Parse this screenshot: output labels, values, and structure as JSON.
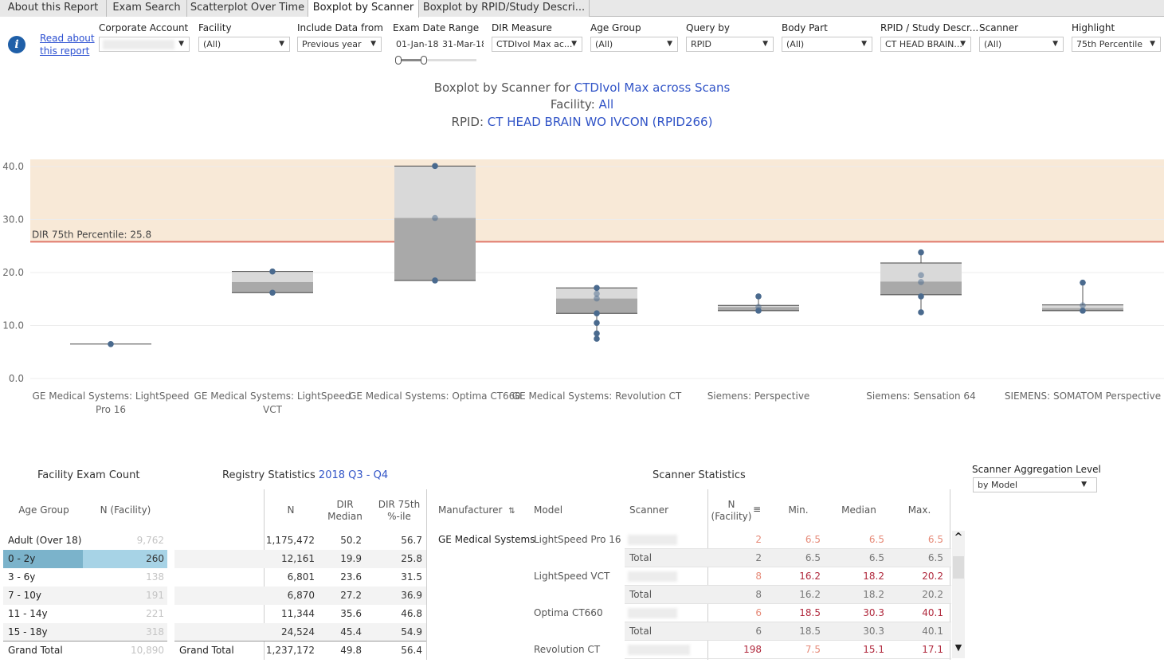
{
  "tabs": [
    {
      "label": "About this Report"
    },
    {
      "label": "Exam Search"
    },
    {
      "label": "Scatterplot Over Time"
    },
    {
      "label": "Boxplot by Scanner"
    },
    {
      "label": "Boxplot by RPID/Study Descri..."
    }
  ],
  "read_about": {
    "line1": "Read about",
    "line2": "this report"
  },
  "filters": {
    "corporate_account": {
      "label": "Corporate Account",
      "value": ""
    },
    "facility": {
      "label": "Facility",
      "value": "(All)"
    },
    "include_data_from": {
      "label": "Include Data from",
      "value": "Previous year"
    },
    "exam_date_range": {
      "label": "Exam Date Range",
      "start": "01-Jan-18",
      "end": "31-Mar-18"
    },
    "dir_measure": {
      "label": "DIR Measure",
      "value": "CTDIvol Max ac..."
    },
    "age_group": {
      "label": "Age Group",
      "value": "(All)"
    },
    "query_by": {
      "label": "Query by",
      "value": "RPID"
    },
    "body_part": {
      "label": "Body Part",
      "value": "(All)"
    },
    "rpid_study": {
      "label": "RPID / Study Descr...",
      "value": "CT HEAD BRAIN..."
    },
    "scanner": {
      "label": "Scanner",
      "value": "(All)"
    },
    "highlight": {
      "label": "Highlight",
      "value": "75th Percentile"
    }
  },
  "title": {
    "line1_prefix": "Boxplot by Scanner for ",
    "line1_measure": "CTDIvol Max across Scans",
    "line2_prefix": "Facility: ",
    "line2_value": "All",
    "line3_prefix": "RPID: ",
    "line3_value": "CT HEAD BRAIN WO IVCON (RPID266)"
  },
  "chart_data": {
    "type": "boxplot",
    "ylim": [
      0,
      42.5
    ],
    "yticks": [
      0,
      10,
      20,
      30,
      40
    ],
    "ytick_labels": [
      "0.0",
      "10.0",
      "20.0",
      "30.0",
      "40.0"
    ],
    "reference_line": {
      "label": "DIR 75th Percentile: 25.8",
      "value": 25.8
    },
    "categories": [
      "GE Medical Systems: LightSpeed Pro 16",
      "GE Medical Systems: LightSpeed VCT",
      "GE Medical Systems: Optima CT660",
      "GE Medical Systems: Revolution CT",
      "Siemens: Perspective",
      "Siemens: Sensation 64",
      "SIEMENS: SOMATOM Perspective"
    ],
    "category_lines": [
      [
        "GE Medical Systems: LightSpeed",
        "Pro 16"
      ],
      [
        "GE Medical Systems: LightSpeed",
        "VCT"
      ],
      [
        "GE Medical Systems: Optima CT660"
      ],
      [
        "GE Medical Systems: Revolution CT"
      ],
      [
        "Siemens: Perspective"
      ],
      [
        "Siemens: Sensation 64"
      ],
      [
        "SIEMENS: SOMATOM Perspective"
      ]
    ],
    "boxes": [
      {
        "min": 6.5,
        "q1": 6.5,
        "median": 6.5,
        "q3": 6.5,
        "max": 6.5,
        "points": [
          6.5
        ]
      },
      {
        "min": 16.2,
        "q1": 16.2,
        "median": 18.2,
        "q3": 20.2,
        "max": 20.2,
        "points": [
          16.2,
          20.2
        ]
      },
      {
        "min": 18.5,
        "q1": 18.5,
        "median": 30.3,
        "q3": 40.1,
        "max": 40.1,
        "points": [
          18.5,
          30.3,
          40.1
        ]
      },
      {
        "min": 7.5,
        "q1": 12.3,
        "median": 15.1,
        "q3": 17.1,
        "max": 17.1,
        "points": [
          7.5,
          8.5,
          10.5,
          12.3,
          15.1,
          16.0,
          17.1
        ]
      },
      {
        "min": 12.8,
        "q1": 12.8,
        "median": 13.5,
        "q3": 13.8,
        "max": 15.5,
        "points": [
          12.8,
          13.5,
          15.5
        ]
      },
      {
        "min": 12.5,
        "q1": 15.8,
        "median": 18.3,
        "q3": 21.8,
        "max": 23.8,
        "points": [
          12.5,
          15.5,
          18.2,
          19.5,
          23.8
        ]
      },
      {
        "min": 12.8,
        "q1": 12.8,
        "median": 13.3,
        "q3": 13.9,
        "max": 18.1,
        "points": [
          12.8,
          13.8,
          18.1
        ]
      }
    ]
  },
  "facility_exam_count": {
    "title": "Facility Exam Count",
    "col_age_group": "Age Group",
    "col_n": "N (Facility)",
    "rows": [
      {
        "age": "Adult (Over 18)",
        "n": "9,762"
      },
      {
        "age": "0 - 2y",
        "n": "260"
      },
      {
        "age": "3 - 6y",
        "n": "138"
      },
      {
        "age": "7 - 10y",
        "n": "191"
      },
      {
        "age": "11 - 14y",
        "n": "221"
      },
      {
        "age": "15 - 18y",
        "n": "318"
      }
    ],
    "grand_total": {
      "label": "Grand Total",
      "n": "10,890"
    }
  },
  "registry_statistics": {
    "title_prefix": "Registry Statistics ",
    "title_period": "2018 Q3 - Q4",
    "col_n": "N",
    "col_median_1": "DIR",
    "col_median_2": "Median",
    "col_p75_1": "DIR 75th",
    "col_p75_2": "%-ile",
    "rows": [
      {
        "n": "1,175,472",
        "median": "50.2",
        "p75": "56.7"
      },
      {
        "n": "12,161",
        "median": "19.9",
        "p75": "25.8"
      },
      {
        "n": "6,801",
        "median": "23.6",
        "p75": "31.5"
      },
      {
        "n": "6,870",
        "median": "27.2",
        "p75": "36.9"
      },
      {
        "n": "11,344",
        "median": "35.6",
        "p75": "46.8"
      },
      {
        "n": "24,524",
        "median": "45.4",
        "p75": "54.9"
      }
    ],
    "grand_total": {
      "label": "Grand Total",
      "n": "1,237,172",
      "median": "49.8",
      "p75": "56.4"
    }
  },
  "scanner_statistics": {
    "title": "Scanner Statistics",
    "col_manufacturer": "Manufacturer",
    "col_model": "Model",
    "col_scanner": "Scanner",
    "col_n_1": "N",
    "col_n_2": "(Facility)",
    "col_min": "Min.",
    "col_median": "Median",
    "col_max": "Max.",
    "rows": [
      {
        "manufacturer": "GE Medical Systems",
        "model": "LightSpeed Pro 16",
        "scanner": "",
        "n": "2",
        "min": "6.5",
        "median": "6.5",
        "max": "6.5",
        "style": "pink"
      },
      {
        "manufacturer": "",
        "model": "",
        "scanner": "Total",
        "n": "2",
        "min": "6.5",
        "median": "6.5",
        "max": "6.5",
        "style": "total"
      },
      {
        "manufacturer": "",
        "model": "LightSpeed VCT",
        "scanner": "",
        "n": "8",
        "min": "16.2",
        "median": "18.2",
        "max": "20.2",
        "style": "red"
      },
      {
        "manufacturer": "",
        "model": "",
        "scanner": "Total",
        "n": "8",
        "min": "16.2",
        "median": "18.2",
        "max": "20.2",
        "style": "total"
      },
      {
        "manufacturer": "",
        "model": "Optima CT660",
        "scanner": "",
        "n": "6",
        "min": "18.5",
        "median": "30.3",
        "max": "40.1",
        "style": "red"
      },
      {
        "manufacturer": "",
        "model": "",
        "scanner": "Total",
        "n": "6",
        "min": "18.5",
        "median": "30.3",
        "max": "40.1",
        "style": "total"
      },
      {
        "manufacturer": "",
        "model": "Revolution CT",
        "scanner": "",
        "n": "198",
        "min": "7.5",
        "median": "15.1",
        "max": "17.1",
        "style": "mixed"
      }
    ]
  },
  "scanner_aggregation": {
    "label": "Scanner Aggregation Level",
    "value": "by Model"
  },
  "colors": {
    "highlight_band": "#f8e9d7",
    "reference_line": "#e0786b",
    "box_dark": "#a9a9a9",
    "box_light": "#d9d9d9",
    "point": "#4a6a8e",
    "link": "#3154c7",
    "row_highlight": "#a7d3e6",
    "row_highlight_dark": "#7bb3cb"
  }
}
